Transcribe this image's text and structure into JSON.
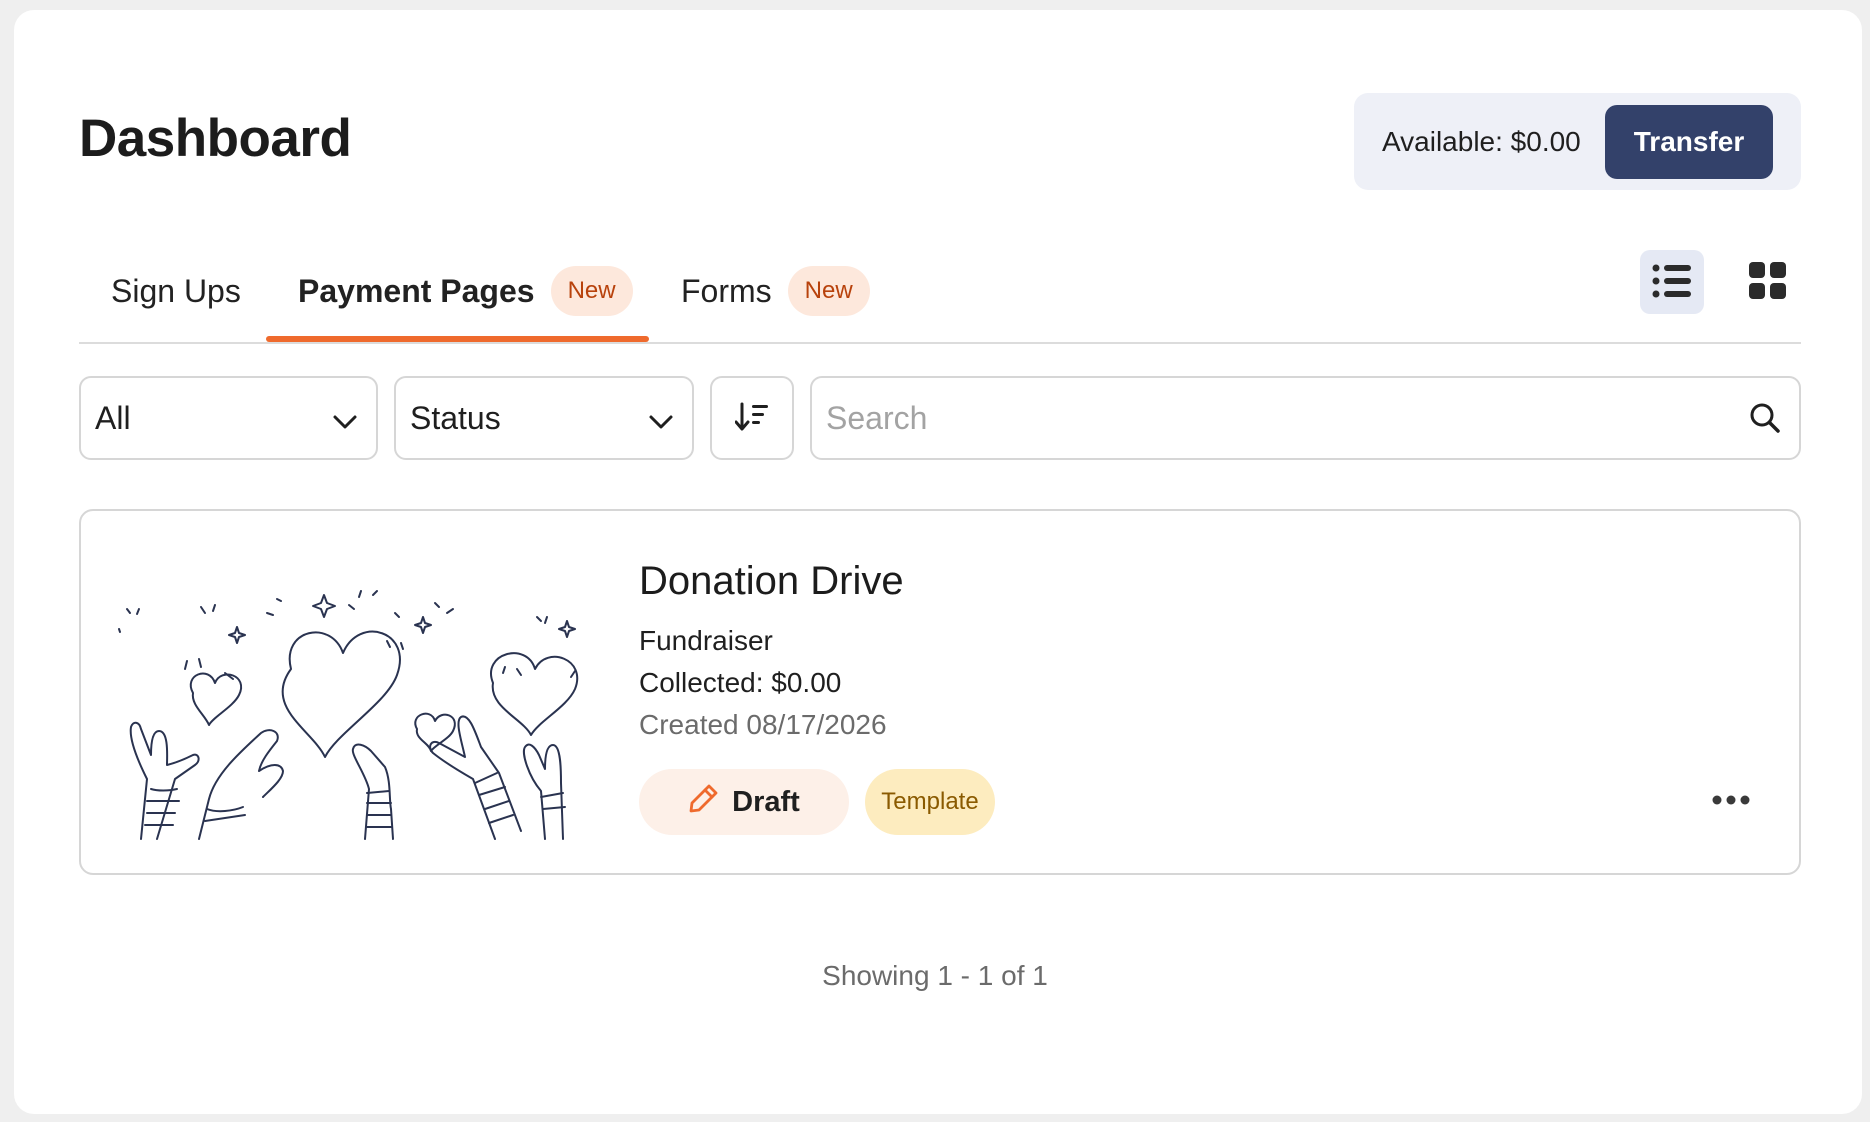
{
  "header": {
    "title": "Dashboard",
    "available": "Available: $0.00",
    "transfer_label": "Transfer"
  },
  "tabs": [
    {
      "label": "Sign Ups"
    },
    {
      "label": "Payment Pages",
      "badge": "New",
      "active": true
    },
    {
      "label": "Forms",
      "badge": "New"
    }
  ],
  "view_toggle": {
    "selected": "list",
    "icons": [
      "list-icon",
      "grid-icon"
    ]
  },
  "filters": {
    "type_selected": "All",
    "status_selected": "Status",
    "sort_icon": "sort-descending-icon",
    "search_placeholder": "Search"
  },
  "items": [
    {
      "title": "Donation Drive",
      "type": "Fundraiser",
      "collected": "Collected: $0.00",
      "created": "Created 08/17/2026",
      "status": "Draft",
      "tag": "Template",
      "image": "hands-holding-hearts-illustration"
    }
  ],
  "pagination": {
    "text": "Showing 1 - 1 of 1"
  },
  "colors": {
    "accent": "#ef6a2d",
    "primary_button": "#33416a",
    "badge_bg": "#fde8dc",
    "badge_text": "#b8420c",
    "template_bg": "#fdecbf",
    "draft_bg": "#fdf0e8"
  }
}
